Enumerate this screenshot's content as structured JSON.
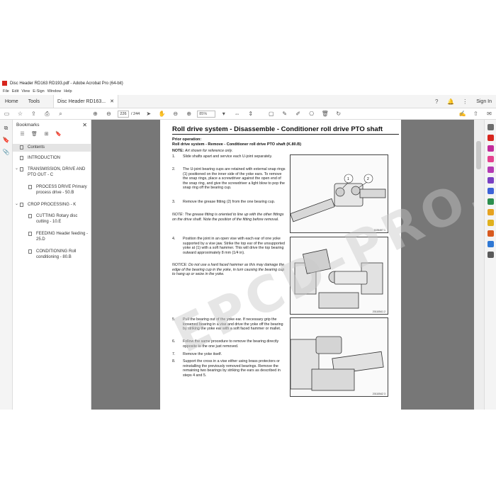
{
  "window": {
    "title": "Disc Header RD163 RD193.pdf - Adobe Acrobat Pro (64-bit)"
  },
  "menu": [
    "File",
    "Edit",
    "View",
    "E-Sign",
    "Window",
    "Help"
  ],
  "tabs": {
    "home": "Home",
    "tools": "Tools",
    "document": "Disc Header RD163...",
    "signin": "Sign In"
  },
  "toolbar": {
    "page_current": "226",
    "page_total": "/ 244",
    "zoom": "85%"
  },
  "bookmarks": {
    "title": "Bookmarks",
    "items": [
      {
        "label": "Contents"
      },
      {
        "label": "INTRODUCTION"
      },
      {
        "label": "TRANSMISSION, DRIVE AND PTO OUT - C"
      },
      {
        "label": "PROCESS DRIVE Primary process drive - 50.B"
      },
      {
        "label": "CROP PROCESSING - K"
      },
      {
        "label": "CUTTING Rotary disc cutting - 10.E"
      },
      {
        "label": "FEEDING Header feeding - 25.D"
      },
      {
        "label": "CONDITIONING Roll conditioning - 80.B"
      }
    ]
  },
  "page": {
    "title": "Roll drive system - Disassemble - Conditioner roll drive PTO shaft",
    "prior_label": "Prior operation:",
    "prior_op": "Roll drive system - Remove - Conditioner roll drive PTO shaft (K.80.B)",
    "note_label": "NOTE:",
    "note_text": "Art shown for reference only.",
    "steps": [
      {
        "n": "1.",
        "text": "Slide shafts apart and service each U-joint separately."
      },
      {
        "n": "2.",
        "text": "The U-joint bearing cups are retained with external snap rings (1) positioned on the inner side of the yoke ears. To remove the snap rings, place a screwdriver against the open end of the snap ring, and give the screwdriver a light blow to pop the snap ring off the bearing cup."
      },
      {
        "n": "3.",
        "text": "Remove the grease fitting (2) from the one bearing cup."
      },
      {
        "n": "4.",
        "text": "Position the joint in an open vise with each ear of one yoke supported by a vise jaw. Strike the top ear of the unsupported yoke at (1) with a soft hammer. This will drive the top bearing outward approximately 8 mm (1/4 in)."
      },
      {
        "n": "5.",
        "text": "Pull the bearing out of the yoke ear. If necessary grip the loosened bearing in a vise and drive the yoke off the bearing by striking the yoke ear with a soft faced hammer or mallet."
      },
      {
        "n": "6.",
        "text": "Follow the same procedure to remove the bearing directly opposite to the one just removed."
      },
      {
        "n": "7.",
        "text": "Remove the yoke itself."
      },
      {
        "n": "8.",
        "text": "Support the cross in a vise either using brass protectors or reinstalling the previously removed bearings. Remove the remaining two bearings by striking the ears as described in steps 4 and 5."
      }
    ],
    "note2": "NOTE: The grease fitting is oriented to line up with the other fittings on the drive shaft. Note the position of the fitting before removal.",
    "note3": "NOTICE: Do not use a hard faced hammer as this may damage the edge of the bearing cup in the yoke, in turn causing the bearing cup to hang up or seize in the yoke.",
    "fig1_callouts": [
      "1",
      "2"
    ],
    "fig1_caption": "1025497   1",
    "fig2_caption": "20110541   2",
    "fig3_caption": "20110542   3"
  },
  "watermark": "EPCD-PRO.COM"
}
